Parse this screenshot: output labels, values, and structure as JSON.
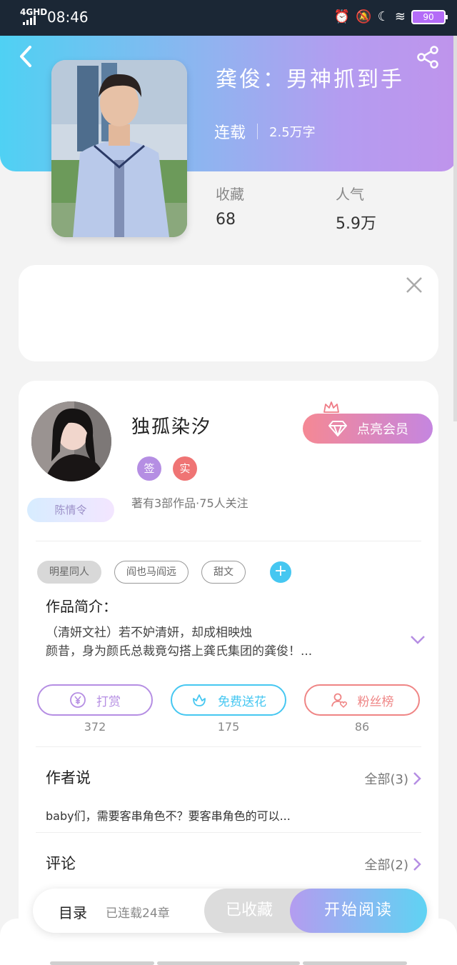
{
  "status_bar": {
    "network": "4GHD",
    "time": "08:46",
    "battery": "90"
  },
  "book": {
    "title": "龚俊：男神抓到手",
    "status": "连载",
    "word_count": "2.5万字",
    "stats": [
      {
        "label": "收藏",
        "value": "68"
      },
      {
        "label": "人气",
        "value": "5.9万"
      }
    ]
  },
  "author": {
    "name": "独孤染汐",
    "badges": [
      "签",
      "实"
    ],
    "fan_tag": "陈情令",
    "meta": "著有3部作品·75人关注",
    "vip_button": "点亮会员"
  },
  "tags": [
    "明星同人",
    "阎也马阎远",
    "甜文"
  ],
  "intro": {
    "title": "作品简介：",
    "text_line1": "（清妍文社）若不妒清妍，却成相映烛",
    "text_line2": "颜昔，身为颜氏总裁竟勾搭上龚氏集团的龚俊！..."
  },
  "actions": [
    {
      "label": "打赏",
      "count": "372",
      "color": "#b58ee3"
    },
    {
      "label": "免费送花",
      "count": "175",
      "color": "#46c7f1"
    },
    {
      "label": "粉丝榜",
      "count": "86",
      "color": "#ef8585"
    }
  ],
  "author_says": {
    "title": "作者说",
    "more": "全部(3)",
    "note": "baby们，需要客串角色不？要客串角色的可以..."
  },
  "comments": {
    "title": "评论",
    "more": "全部(2)"
  },
  "bottom_bar": {
    "toc": "目录",
    "chapters": "已连载24章",
    "favorited": "已收藏",
    "start_reading": "开始阅读"
  },
  "colors": {
    "header_gradient_start": "#4fd1f3",
    "header_gradient_end": "#bf94ec",
    "accent_blue": "#46c7f1",
    "accent_purple": "#b49cf0"
  }
}
